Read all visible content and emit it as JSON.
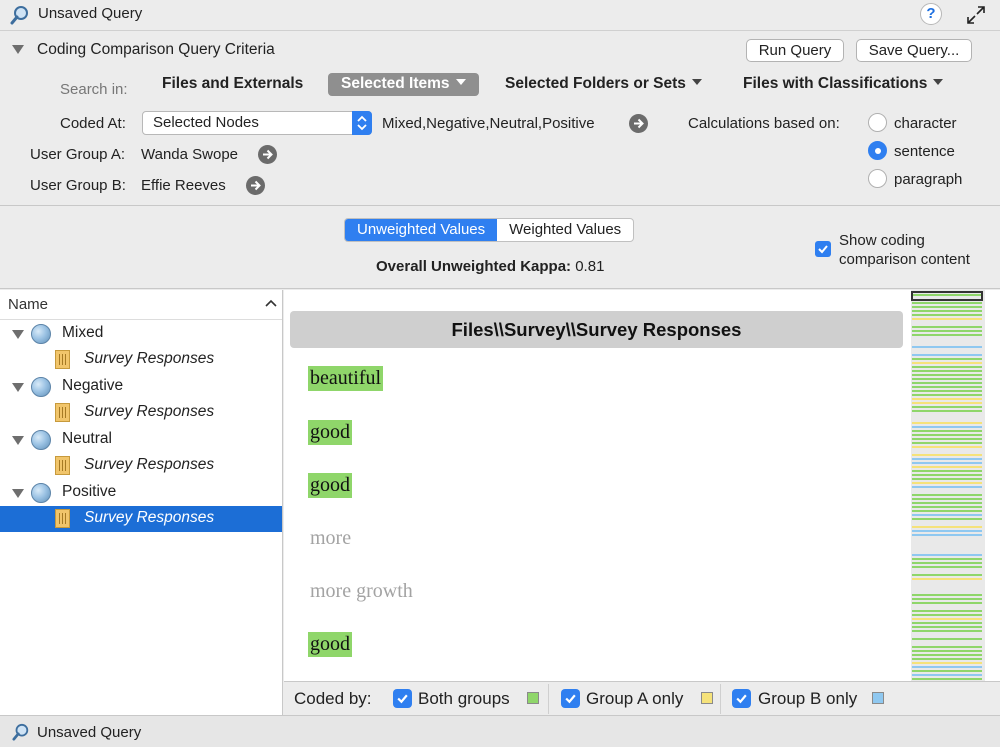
{
  "window": {
    "title": "Unsaved Query",
    "help_label": "?"
  },
  "criteria": {
    "title": "Coding Comparison Query Criteria",
    "run_label": "Run Query",
    "save_label": "Save Query...",
    "search_in_label": "Search in:",
    "search_options": [
      {
        "label": "Files and Externals",
        "selected": false,
        "has_menu": false
      },
      {
        "label": "Selected Items",
        "selected": true,
        "has_menu": true
      },
      {
        "label": "Selected Folders or Sets",
        "selected": false,
        "has_menu": true
      },
      {
        "label": "Files with Classifications",
        "selected": false,
        "has_menu": true
      }
    ],
    "coded_at_label": "Coded At:",
    "coded_at_value": "Selected Nodes",
    "coded_at_nodes": "Mixed,Negative,Neutral,Positive",
    "user_group_a_label": "User Group A:",
    "user_group_a_value": "Wanda Swope",
    "user_group_b_label": "User Group B:",
    "user_group_b_value": "Effie Reeves",
    "calc_label": "Calculations based on:",
    "calc_options": [
      "character",
      "sentence",
      "paragraph"
    ],
    "calc_selected": "sentence"
  },
  "values": {
    "unweighted_label": "Unweighted Values",
    "weighted_label": "Weighted Values",
    "kappa_label": "Overall Unweighted Kappa:",
    "kappa_value": "0.81",
    "show_content_label_1": "Show coding",
    "show_content_label_2": "comparison content",
    "show_content_checked": true
  },
  "tree": {
    "header": "Name",
    "nodes": [
      {
        "label": "Mixed",
        "child": "Survey Responses"
      },
      {
        "label": "Negative",
        "child": "Survey Responses"
      },
      {
        "label": "Neutral",
        "child": "Survey Responses"
      },
      {
        "label": "Positive",
        "child": "Survey Responses"
      }
    ],
    "selected_index": 3
  },
  "content": {
    "file_path": "Files\\\\Survey\\\\Survey Responses",
    "snippets": [
      {
        "text": "beautiful",
        "coding": "both"
      },
      {
        "text": "good",
        "coding": "both"
      },
      {
        "text": "good",
        "coding": "both"
      },
      {
        "text": "more",
        "coding": "none"
      },
      {
        "text": "more growth",
        "coding": "none"
      },
      {
        "text": "good",
        "coding": "both"
      }
    ]
  },
  "coded_by": {
    "label": "Coded by:",
    "items": [
      {
        "label": "Both groups",
        "color": "#8fd66a",
        "checked": true
      },
      {
        "label": "Group A only",
        "color": "#f5e27a",
        "checked": true
      },
      {
        "label": "Group B only",
        "color": "#8fc8f0",
        "checked": true
      }
    ]
  },
  "colors": {
    "accent": "#2f7ff0",
    "both": "#8fd66a",
    "group_a": "#f5e27a",
    "group_b": "#8fc8f0"
  },
  "status": {
    "title": "Unsaved Query"
  }
}
